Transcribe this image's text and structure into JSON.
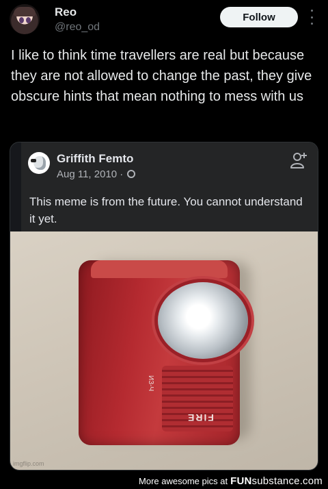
{
  "author": {
    "name": "Reo",
    "handle": "@reo_od",
    "follow_label": "Follow"
  },
  "tweet": {
    "text": "I like to think time travellers are real but because they are not allowed to change the past, they give obscure hints that mean nothing to mess with us"
  },
  "quoted_post": {
    "name": "Griffith Femto",
    "date": "Aug 11, 2010 ·",
    "text": "This meme is from the future. You cannot understand it yet.",
    "image": {
      "alt_text_visible": "FIRE",
      "side_text": "ИЗ-Ч",
      "watermark": "imgflip.com"
    }
  },
  "footer": {
    "text": "More awesome pics at",
    "brand_bold": "FUN",
    "brand_rest": "substance.com"
  },
  "icons": {
    "more": "more-vertical-icon",
    "globe": "globe-icon",
    "add_friend": "add-friend-icon"
  },
  "colors": {
    "background": "#000000",
    "follow_button": "#eff3f4",
    "card": "#242526",
    "alarm_red": "#b52a30"
  }
}
